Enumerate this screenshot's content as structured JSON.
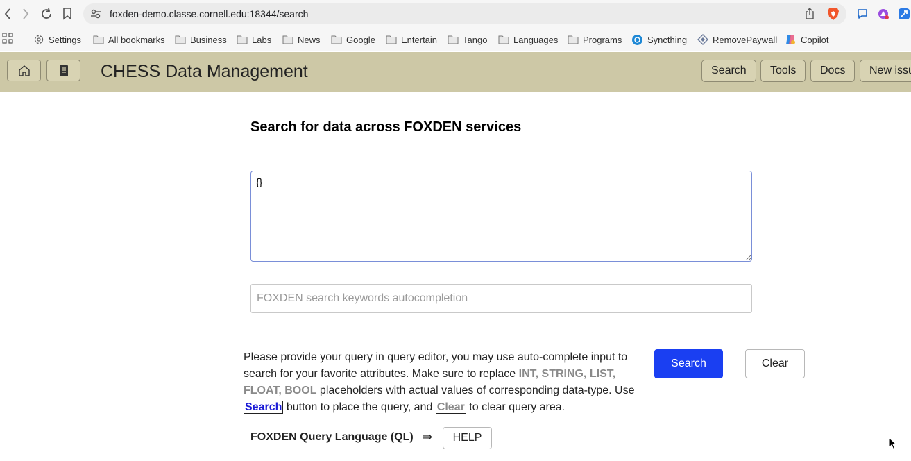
{
  "browser": {
    "url": "foxden-demo.classe.cornell.edu:18344/search"
  },
  "bookmarks": [
    {
      "label": "Settings",
      "icon": "gear-icon"
    },
    {
      "label": "All bookmarks",
      "icon": "folder-icon"
    },
    {
      "label": "Business",
      "icon": "folder-icon"
    },
    {
      "label": "Labs",
      "icon": "folder-icon"
    },
    {
      "label": "News",
      "icon": "folder-icon"
    },
    {
      "label": "Google",
      "icon": "folder-icon"
    },
    {
      "label": "Entertain",
      "icon": "folder-icon"
    },
    {
      "label": "Tango",
      "icon": "folder-icon"
    },
    {
      "label": "Languages",
      "icon": "folder-icon"
    },
    {
      "label": "Programs",
      "icon": "folder-icon"
    },
    {
      "label": "Syncthing",
      "icon": "syncthing-icon"
    },
    {
      "label": "RemovePaywall",
      "icon": "diamond-icon"
    },
    {
      "label": "Copilot",
      "icon": "copilot-icon"
    }
  ],
  "header": {
    "title": "CHESS Data Management",
    "nav": {
      "search": "Search",
      "tools": "Tools",
      "docs": "Docs",
      "new_issue": "New issu"
    }
  },
  "main": {
    "heading": "Search for data across FOXDEN services",
    "query_value": "{}",
    "autocomplete_placeholder": "FOXDEN search keywords autocompletion",
    "instructions": {
      "part1": "Please provide your query in query editor, you may use auto-complete input to search for your favorite attributes. Make sure to replace ",
      "placeholders": "INT, STRING, LIST, FLOAT, BOOL",
      "part2": " placeholders with actual values of corresponding data-type. Use ",
      "search_kw": "Search",
      "part3": " button to place the query, and ",
      "clear_kw": "Clear",
      "part4": " to clear query area."
    },
    "search_button": "Search",
    "clear_button": "Clear",
    "ql_label": "FOXDEN Query Language (QL)",
    "ql_arrow": "⇒",
    "help_button": "HELP"
  },
  "colors": {
    "header_bg": "#cdc8a6",
    "primary_button": "#1a3ff2",
    "search_keyword": "#1a1ad6",
    "placeholder_keyword": "#8a8a8a"
  }
}
